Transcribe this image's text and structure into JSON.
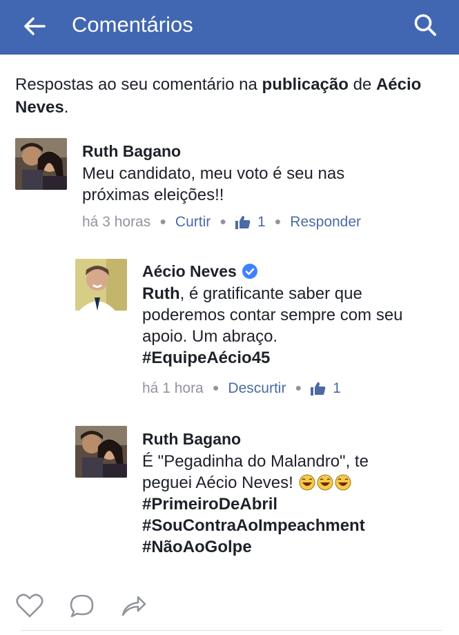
{
  "header": {
    "title": "Comentários",
    "back_icon": "arrow-left-icon",
    "search_icon": "search-icon",
    "bg_color": "#4267b2"
  },
  "intro": {
    "prefix": "Respostas ao seu comentário na ",
    "bold1": "publicação",
    "middle": " de ",
    "bold2": "Aécio Neves",
    "suffix": "."
  },
  "comments": [
    {
      "author": "Ruth Bagano",
      "text": "Meu candidato, meu voto é seu nas próximas eleições!!",
      "time": "há 3 horas",
      "like_label": "Curtir",
      "likes": "1",
      "reply_label": "Responder"
    },
    {
      "author": "Aécio Neves",
      "verified": true,
      "mention": "Ruth",
      "text": ", é gratificante saber que poderemos contar sempre com seu apoio. Um abraço.",
      "hashtag": "#EquipeAécio45",
      "time": "há 1 hora",
      "like_label": "Descurtir",
      "likes": "1"
    },
    {
      "author": "Ruth Bagano",
      "text_line1": "É \"Pegadinha do Malandro\", te",
      "text_line2": "peguei Aécio Neves!",
      "emoji": "laughing-emoji",
      "hashtags": [
        "#PrimeiroDeAbril",
        "#SouContraAoImpeachment",
        "#NãoAoGolpe"
      ]
    }
  ],
  "footer_actions": [
    "heart-icon",
    "comment-bubble-icon",
    "share-arrow-icon"
  ],
  "colors": {
    "link": "#4b6ba2",
    "meta": "#90949c",
    "text": "#1d2129",
    "verified": "#4080ff"
  }
}
